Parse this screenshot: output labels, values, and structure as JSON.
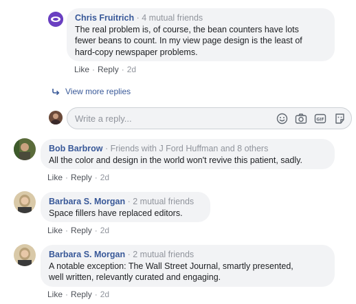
{
  "comments": [
    {
      "author": "Chris Fruitrich",
      "meta": "4 mutual friends",
      "text_lines": [
        "The real problem is, of course, the bean counters have lots",
        "fewer beans to count. In my view page design is the least of",
        "hard-copy newspaper problems."
      ],
      "like": "Like",
      "reply": "Reply",
      "time": "2d"
    },
    {
      "author": "Bob Barbrow",
      "meta": "Friends with J Ford Huffman and 8 others",
      "text_lines": [
        "All the color and design in the world won't revive this patient, sadly."
      ],
      "like": "Like",
      "reply": "Reply",
      "time": "2d"
    },
    {
      "author": "Barbara S. Morgan",
      "meta": "2 mutual friends",
      "text_lines": [
        "Space fillers have replaced editors."
      ],
      "like": "Like",
      "reply": "Reply",
      "time": "2d"
    },
    {
      "author": "Barbara S. Morgan",
      "meta": "2 mutual friends",
      "text_lines": [
        "A notable exception: The Wall Street Journal, smartly presented,",
        "well written, relevantly curated and engaging."
      ],
      "like": "Like",
      "reply": "Reply",
      "time": "2d"
    }
  ],
  "view_more_replies": "View more replies",
  "reply_input": {
    "placeholder": "Write a reply..."
  },
  "reply_icons": [
    "emoji-icon",
    "camera-icon",
    "gif-icon",
    "sticker-icon"
  ],
  "colors": {
    "author": "#385898",
    "meta": "#90949c",
    "bubble": "#f2f3f5",
    "link": "#4b4f56"
  }
}
